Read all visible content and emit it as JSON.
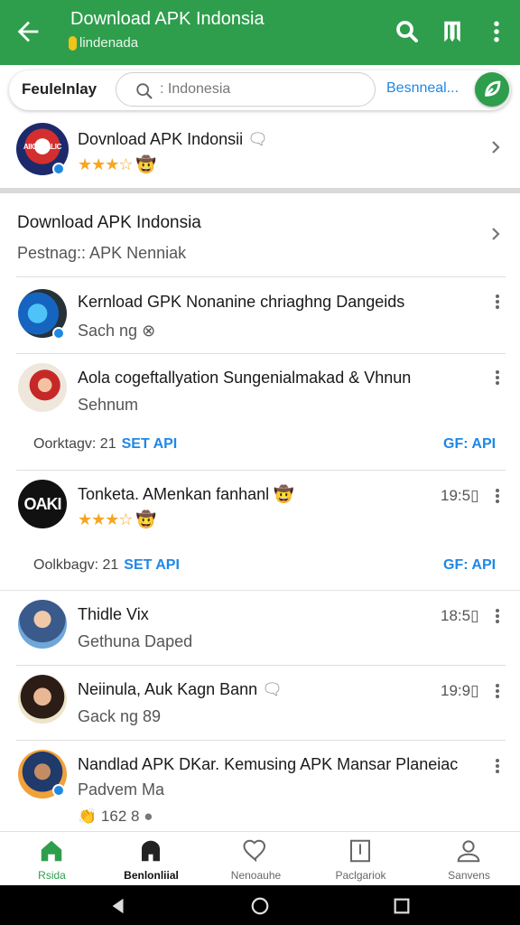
{
  "appbar": {
    "title": "Download APK Indonsia",
    "subtitle": "lindenada",
    "icons": [
      "back-arrow-icon",
      "search-icon",
      "bookmark-icon",
      "more-vert-icon"
    ],
    "color": "#2e9e4c"
  },
  "search": {
    "label": "Feulelnlay",
    "placeholder": ": Indonesia",
    "link": "Besnneal...",
    "fab_icon": "leaf-icon"
  },
  "featured": {
    "logo_text": "AIICALALIC",
    "name": "Dovnload APK Indonsii",
    "rating": "★★★☆",
    "emoji": "🤠"
  },
  "section": {
    "title": "Download APK Indonsia",
    "subtitle": "Pestnag:: APK Nenniak"
  },
  "items": [
    {
      "title": "Kernload GPK Nonanine chriaghng Dangeids",
      "sub": "Sach ng",
      "sub_icon": "⊗"
    },
    {
      "title": "Aola cogeftallyation Sungenialmakad & Vhnun",
      "sub": "Sehnum"
    },
    {
      "title": "Tonketa. AMenkan fanhanl",
      "emoji": "🤠",
      "stars": "★★★☆",
      "time": "19:5▯",
      "avatar_text": "OAKI"
    },
    {
      "title": "Thidle Vix",
      "sub": "Gethuna Daped",
      "time": "18:5▯"
    },
    {
      "title": "Neiinula, Auk Kagn Bann",
      "sub": "Gack ng 89",
      "time": "19:9▯"
    },
    {
      "title": "Nandlad APK DKar. Kemusing APK Mansar Planeiac",
      "sub": "Padvem Ma",
      "foot": "162  8"
    }
  ],
  "meta_rows": [
    {
      "left": "Oorktagv: 21",
      "blue": "SET API",
      "right": "GF: API"
    },
    {
      "left": "Oolkbagv: 21",
      "blue": "SET API",
      "right": "GF: API"
    }
  ],
  "bottom_nav": [
    {
      "label": "Rsida",
      "icon": "home-icon",
      "state": "active"
    },
    {
      "label": "Benlonliial",
      "icon": "storefront-icon",
      "state": "bold"
    },
    {
      "label": "Nenoauhe",
      "icon": "heart-icon",
      "state": "normal"
    },
    {
      "label": "Paclgariok",
      "icon": "book-icon",
      "state": "normal"
    },
    {
      "label": "Sanvens",
      "icon": "person-icon",
      "state": "normal"
    }
  ]
}
